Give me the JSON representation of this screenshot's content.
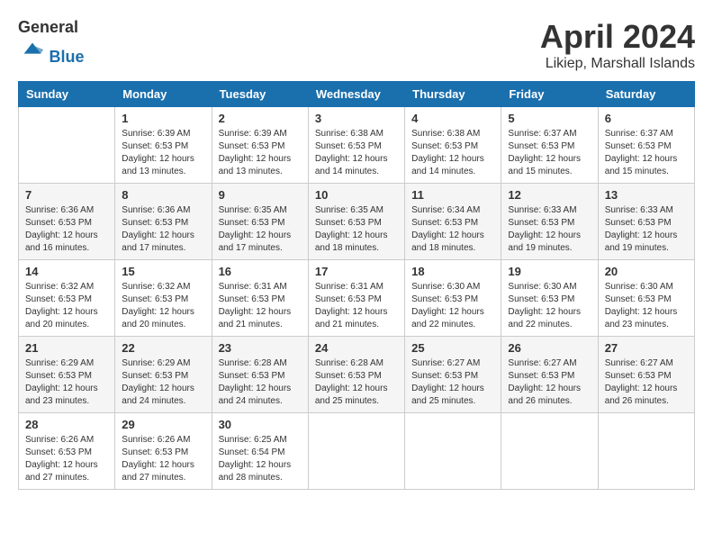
{
  "header": {
    "logo_general": "General",
    "logo_blue": "Blue",
    "month": "April 2024",
    "location": "Likiep, Marshall Islands"
  },
  "weekdays": [
    "Sunday",
    "Monday",
    "Tuesday",
    "Wednesday",
    "Thursday",
    "Friday",
    "Saturday"
  ],
  "weeks": [
    [
      {
        "day": "",
        "info": ""
      },
      {
        "day": "1",
        "info": "Sunrise: 6:39 AM\nSunset: 6:53 PM\nDaylight: 12 hours\nand 13 minutes."
      },
      {
        "day": "2",
        "info": "Sunrise: 6:39 AM\nSunset: 6:53 PM\nDaylight: 12 hours\nand 13 minutes."
      },
      {
        "day": "3",
        "info": "Sunrise: 6:38 AM\nSunset: 6:53 PM\nDaylight: 12 hours\nand 14 minutes."
      },
      {
        "day": "4",
        "info": "Sunrise: 6:38 AM\nSunset: 6:53 PM\nDaylight: 12 hours\nand 14 minutes."
      },
      {
        "day": "5",
        "info": "Sunrise: 6:37 AM\nSunset: 6:53 PM\nDaylight: 12 hours\nand 15 minutes."
      },
      {
        "day": "6",
        "info": "Sunrise: 6:37 AM\nSunset: 6:53 PM\nDaylight: 12 hours\nand 15 minutes."
      }
    ],
    [
      {
        "day": "7",
        "info": "Sunrise: 6:36 AM\nSunset: 6:53 PM\nDaylight: 12 hours\nand 16 minutes."
      },
      {
        "day": "8",
        "info": "Sunrise: 6:36 AM\nSunset: 6:53 PM\nDaylight: 12 hours\nand 17 minutes."
      },
      {
        "day": "9",
        "info": "Sunrise: 6:35 AM\nSunset: 6:53 PM\nDaylight: 12 hours\nand 17 minutes."
      },
      {
        "day": "10",
        "info": "Sunrise: 6:35 AM\nSunset: 6:53 PM\nDaylight: 12 hours\nand 18 minutes."
      },
      {
        "day": "11",
        "info": "Sunrise: 6:34 AM\nSunset: 6:53 PM\nDaylight: 12 hours\nand 18 minutes."
      },
      {
        "day": "12",
        "info": "Sunrise: 6:33 AM\nSunset: 6:53 PM\nDaylight: 12 hours\nand 19 minutes."
      },
      {
        "day": "13",
        "info": "Sunrise: 6:33 AM\nSunset: 6:53 PM\nDaylight: 12 hours\nand 19 minutes."
      }
    ],
    [
      {
        "day": "14",
        "info": "Sunrise: 6:32 AM\nSunset: 6:53 PM\nDaylight: 12 hours\nand 20 minutes."
      },
      {
        "day": "15",
        "info": "Sunrise: 6:32 AM\nSunset: 6:53 PM\nDaylight: 12 hours\nand 20 minutes."
      },
      {
        "day": "16",
        "info": "Sunrise: 6:31 AM\nSunset: 6:53 PM\nDaylight: 12 hours\nand 21 minutes."
      },
      {
        "day": "17",
        "info": "Sunrise: 6:31 AM\nSunset: 6:53 PM\nDaylight: 12 hours\nand 21 minutes."
      },
      {
        "day": "18",
        "info": "Sunrise: 6:30 AM\nSunset: 6:53 PM\nDaylight: 12 hours\nand 22 minutes."
      },
      {
        "day": "19",
        "info": "Sunrise: 6:30 AM\nSunset: 6:53 PM\nDaylight: 12 hours\nand 22 minutes."
      },
      {
        "day": "20",
        "info": "Sunrise: 6:30 AM\nSunset: 6:53 PM\nDaylight: 12 hours\nand 23 minutes."
      }
    ],
    [
      {
        "day": "21",
        "info": "Sunrise: 6:29 AM\nSunset: 6:53 PM\nDaylight: 12 hours\nand 23 minutes."
      },
      {
        "day": "22",
        "info": "Sunrise: 6:29 AM\nSunset: 6:53 PM\nDaylight: 12 hours\nand 24 minutes."
      },
      {
        "day": "23",
        "info": "Sunrise: 6:28 AM\nSunset: 6:53 PM\nDaylight: 12 hours\nand 24 minutes."
      },
      {
        "day": "24",
        "info": "Sunrise: 6:28 AM\nSunset: 6:53 PM\nDaylight: 12 hours\nand 25 minutes."
      },
      {
        "day": "25",
        "info": "Sunrise: 6:27 AM\nSunset: 6:53 PM\nDaylight: 12 hours\nand 25 minutes."
      },
      {
        "day": "26",
        "info": "Sunrise: 6:27 AM\nSunset: 6:53 PM\nDaylight: 12 hours\nand 26 minutes."
      },
      {
        "day": "27",
        "info": "Sunrise: 6:27 AM\nSunset: 6:53 PM\nDaylight: 12 hours\nand 26 minutes."
      }
    ],
    [
      {
        "day": "28",
        "info": "Sunrise: 6:26 AM\nSunset: 6:53 PM\nDaylight: 12 hours\nand 27 minutes."
      },
      {
        "day": "29",
        "info": "Sunrise: 6:26 AM\nSunset: 6:53 PM\nDaylight: 12 hours\nand 27 minutes."
      },
      {
        "day": "30",
        "info": "Sunrise: 6:25 AM\nSunset: 6:54 PM\nDaylight: 12 hours\nand 28 minutes."
      },
      {
        "day": "",
        "info": ""
      },
      {
        "day": "",
        "info": ""
      },
      {
        "day": "",
        "info": ""
      },
      {
        "day": "",
        "info": ""
      }
    ]
  ]
}
